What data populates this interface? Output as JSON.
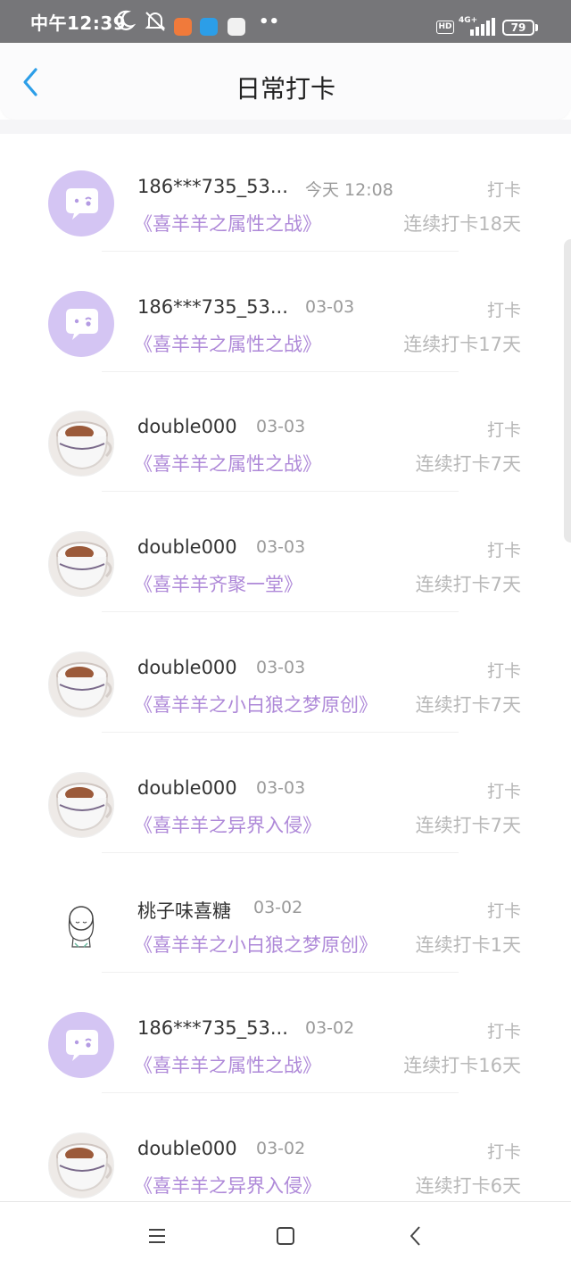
{
  "status_bar": {
    "time": "中午12:39",
    "network": "4G+",
    "hd": "HD",
    "battery": "79",
    "more": "••"
  },
  "header": {
    "title": "日常打卡"
  },
  "items": [
    {
      "name": "186***735_53...",
      "time": "今天 12:08",
      "action": "打卡",
      "book": "《喜羊羊之属性之战》",
      "streak": "连续打卡18天",
      "avatar": "bubble"
    },
    {
      "name": "186***735_53...",
      "time": "03-03",
      "action": "打卡",
      "book": "《喜羊羊之属性之战》",
      "streak": "连续打卡17天",
      "avatar": "bubble"
    },
    {
      "name": "double000",
      "time": "03-03",
      "action": "打卡",
      "book": "《喜羊羊之属性之战》",
      "streak": "连续打卡7天",
      "avatar": "cup"
    },
    {
      "name": "double000",
      "time": "03-03",
      "action": "打卡",
      "book": "《喜羊羊齐聚一堂》",
      "streak": "连续打卡7天",
      "avatar": "cup"
    },
    {
      "name": "double000",
      "time": "03-03",
      "action": "打卡",
      "book": "《喜羊羊之小白狼之梦原创》",
      "streak": "连续打卡7天",
      "avatar": "cup"
    },
    {
      "name": "double000",
      "time": "03-03",
      "action": "打卡",
      "book": "《喜羊羊之异界入侵》",
      "streak": "连续打卡7天",
      "avatar": "cup"
    },
    {
      "name": "桃子味喜糖",
      "time": "03-02",
      "action": "打卡",
      "book": "《喜羊羊之小白狼之梦原创》",
      "streak": "连续打卡1天",
      "avatar": "girl"
    },
    {
      "name": "186***735_53...",
      "time": "03-02",
      "action": "打卡",
      "book": "《喜羊羊之属性之战》",
      "streak": "连续打卡16天",
      "avatar": "bubble"
    },
    {
      "name": "double000",
      "time": "03-02",
      "action": "打卡",
      "book": "《喜羊羊之异界入侵》",
      "streak": "连续打卡6天",
      "avatar": "cup"
    }
  ],
  "icons": {
    "back": "back-arrow-icon",
    "nav_menu": "menu-icon",
    "nav_home": "home-square-icon",
    "nav_back": "back-chevron-icon"
  },
  "colors": {
    "accent_blue": "#2c9ee8",
    "book_purple": "#ae88d8",
    "status_bar": "#767679",
    "bubble_avatar": "#d4c5f3"
  }
}
